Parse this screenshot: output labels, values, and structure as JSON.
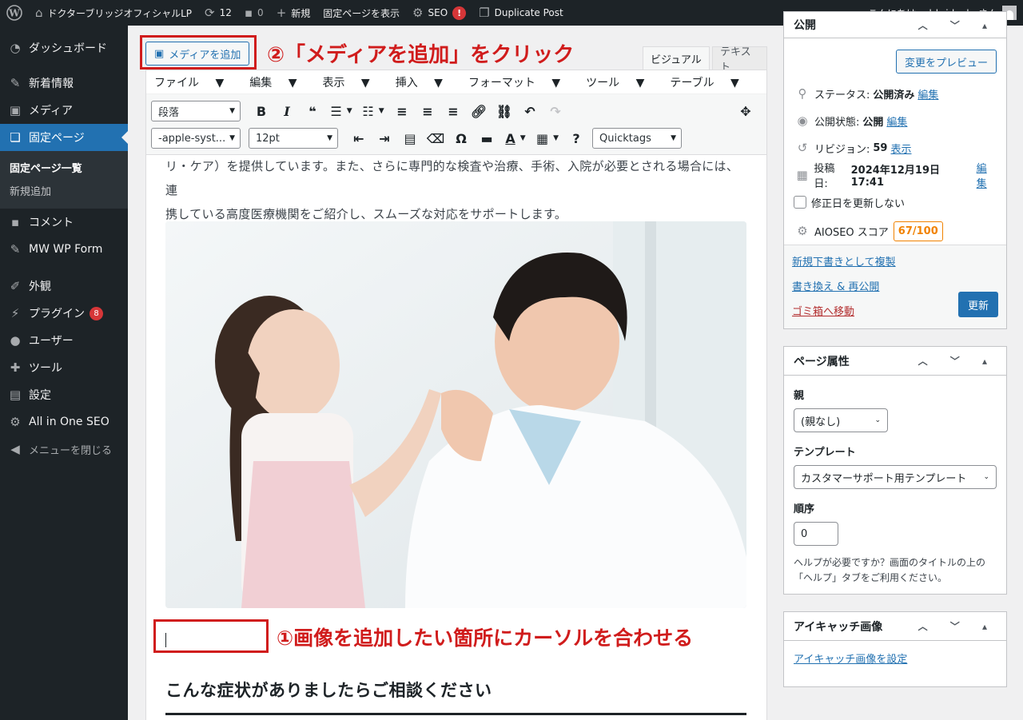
{
  "admin_bar": {
    "site_name": "ドクターブリッジオフィシャルLP",
    "updates_count": "12",
    "comments_count": "0",
    "new_label": "新規",
    "view_page_label": "固定ページを表示",
    "seo_label": "SEO",
    "seo_alert": "!",
    "duplicate_label": "Duplicate Post",
    "greeting": "こんにちは、drbridgelp さん"
  },
  "sidebar": {
    "dashboard": "ダッシュボード",
    "posts": "新着情報",
    "media": "メディア",
    "pages": "固定ページ",
    "pages_list": "固定ページ一覧",
    "pages_new": "新規追加",
    "comments": "コメント",
    "mwwpform": "MW WP Form",
    "appearance": "外観",
    "plugins": "プラグイン",
    "plugins_badge": "8",
    "users": "ユーザー",
    "tools": "ツール",
    "settings": "設定",
    "aioseo": "All in One SEO",
    "collapse": "メニューを閉じる"
  },
  "editor": {
    "add_media_label": "メディアを追加",
    "tab_visual": "ビジュアル",
    "tab_text": "テキスト",
    "menubar": [
      "ファイル",
      "編集",
      "表示",
      "挿入",
      "フォーマット",
      "ツール",
      "テーブル"
    ],
    "format_select": "段落",
    "font_family_select": "-apple-syst...",
    "font_size_select": "12pt",
    "quicktags_select": "Quicktags",
    "paragraph_line1": "リ・ケア）を提供しています。また、さらに専門的な検査や治療、手術、入院が必要とされる場合には、連",
    "paragraph_line2": "携している高度医療機関をご紹介し、スムーズな対応をサポートします。",
    "heading": "こんな症状がありましたらご相談ください"
  },
  "annotations": {
    "step2": "②「メディアを追加」をクリック",
    "step1": "①画像を追加したい箇所にカーソルを合わせる"
  },
  "publish_box": {
    "title": "公開",
    "preview_button": "変更をプレビュー",
    "status_label": "ステータス:",
    "status_value": "公開済み",
    "visibility_label": "公開状態:",
    "visibility_value": "公開",
    "revisions_label": "リビジョン:",
    "revisions_value": "59",
    "revisions_link": "表示",
    "published_label": "投稿日:",
    "published_value": "2024年12月19日 17:41",
    "edit_link": "編集",
    "no_update_date": "修正日を更新しない",
    "aioseo_score_label": "AIOSEO スコア",
    "aioseo_score": "67/100",
    "copy_draft_link": "新規下書きとして複製",
    "rewrite_link": "書き換え & 再公開",
    "trash_link": "ゴミ箱へ移動",
    "update_button": "更新"
  },
  "page_attributes": {
    "title": "ページ属性",
    "parent_label": "親",
    "parent_value": "(親なし)",
    "template_label": "テンプレート",
    "template_value": "カスタマーサポート用テンプレート",
    "order_label": "順序",
    "order_value": "0",
    "help_text": "ヘルプが必要ですか？画面のタイトルの上の「ヘルプ」タブをご利用ください。"
  },
  "featured_image": {
    "title": "アイキャッチ画像",
    "set_link": "アイキャッチ画像を設定"
  },
  "colors": {
    "admin_dark": "#1d2327",
    "accent_blue": "#2271b1",
    "annotation_red": "#d01c1c",
    "score_orange": "#f18200"
  }
}
